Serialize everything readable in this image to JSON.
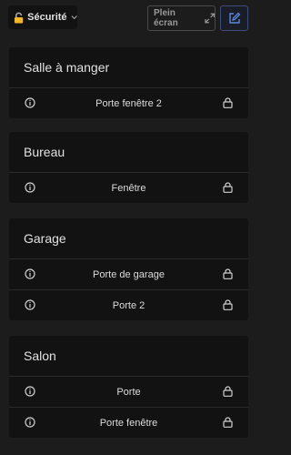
{
  "header": {
    "view_label": "Sécurité",
    "fullscreen_label": "Plein écran"
  },
  "cards": [
    {
      "title": "Salle à manger",
      "items": [
        {
          "label": "Porte fenêtre 2"
        }
      ]
    },
    {
      "title": "Bureau",
      "items": [
        {
          "label": "Fenêtre"
        }
      ]
    },
    {
      "title": "Garage",
      "items": [
        {
          "label": "Porte de garage"
        },
        {
          "label": "Porte 2"
        }
      ]
    },
    {
      "title": "Salon",
      "items": [
        {
          "label": "Porte"
        },
        {
          "label": "Porte fenêtre"
        }
      ]
    }
  ],
  "colors": {
    "background": "#1c1c1c",
    "card": "#121212",
    "accent": "#4f7dd6"
  },
  "icons": {
    "row_left": "info-icon",
    "row_right": "lock-icon"
  }
}
